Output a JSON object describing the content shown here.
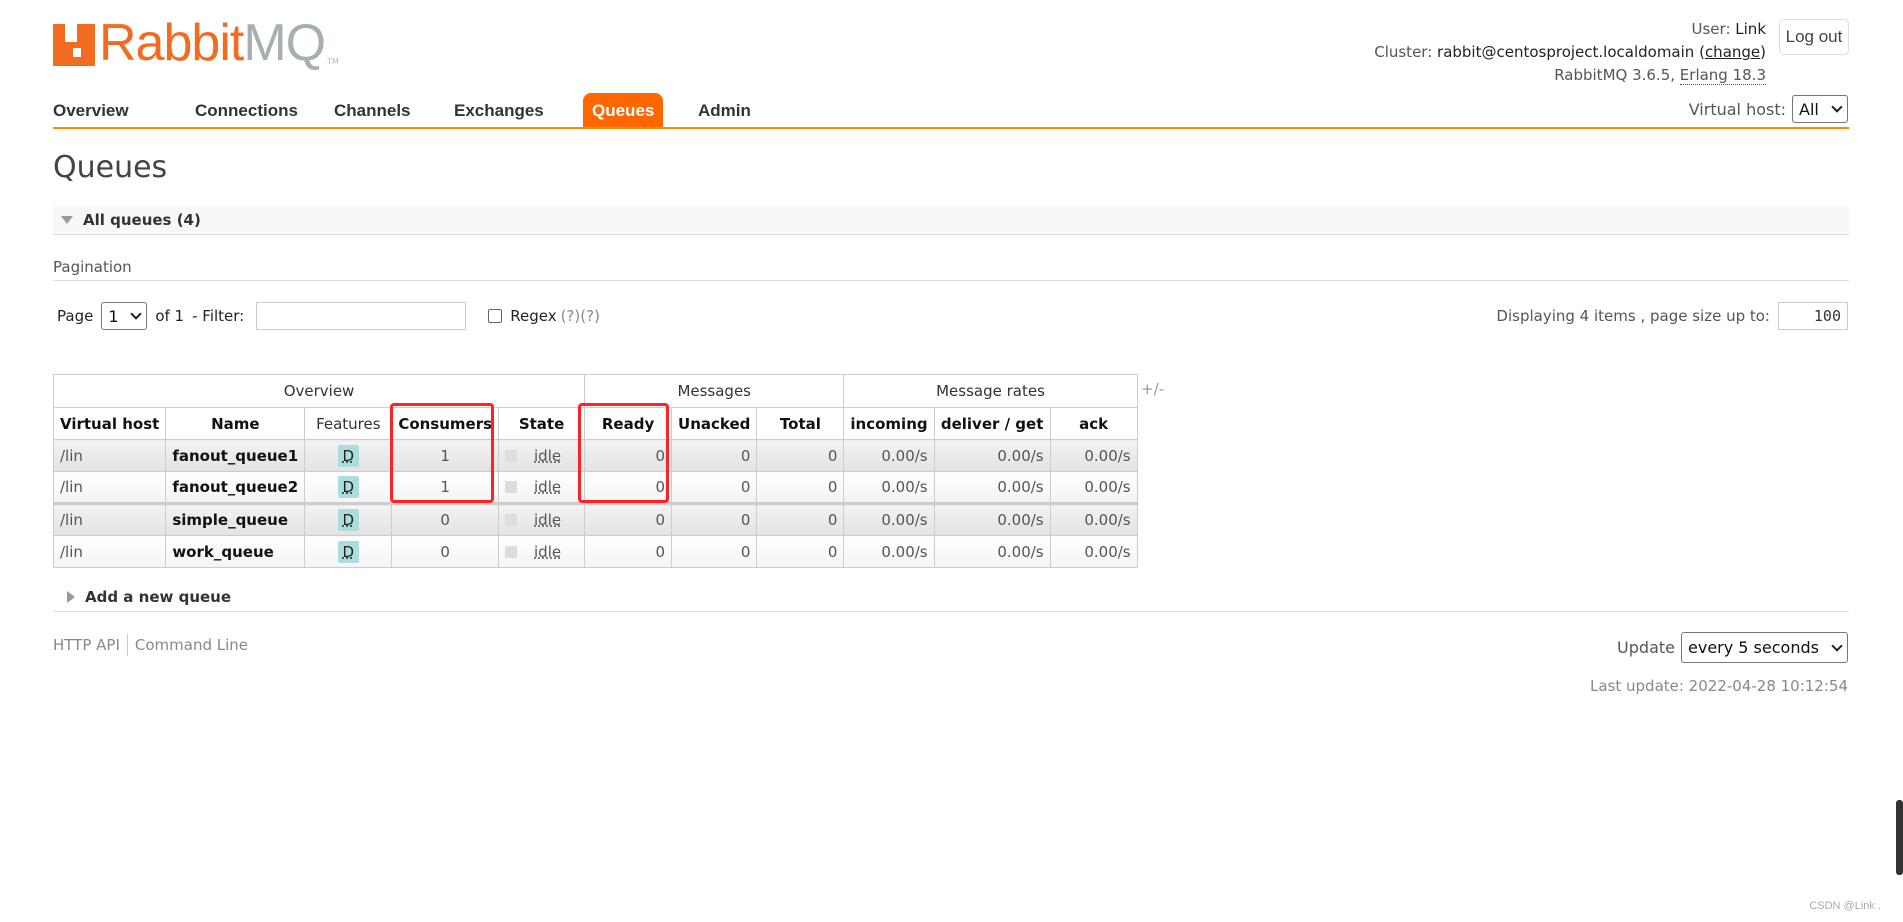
{
  "logo": {
    "text": "RabbitMQ",
    "part1": "Rabbit",
    "part2": "MQ",
    "tm": "TM"
  },
  "header": {
    "user_label": "User:",
    "user": "Link",
    "cluster_label": "Cluster:",
    "cluster": "rabbit@centosproject.localdomain",
    "change_label": "change",
    "version": "RabbitMQ 3.6.5,",
    "erlang": "Erlang 18.3",
    "logout_label": "Log out",
    "vhost_label": "Virtual host:",
    "vhost_value": "All"
  },
  "nav": {
    "tabs": [
      {
        "label": "Overview"
      },
      {
        "label": "Connections"
      },
      {
        "label": "Channels"
      },
      {
        "label": "Exchanges"
      },
      {
        "label": "Queues",
        "active": true
      },
      {
        "label": "Admin"
      }
    ]
  },
  "page": {
    "title": "Queues",
    "section": "All queues (4)",
    "pagination_label": "Pagination"
  },
  "pagination": {
    "page_label": "Page",
    "page_value": "1",
    "of_label": "of 1",
    "filter_label": "- Filter:",
    "filter_value": "",
    "regex_label": "Regex",
    "regex_checked": false,
    "help1": "(?)",
    "help2": "(?)",
    "display_text": "Displaying 4 items , page size up to:",
    "page_size": "100"
  },
  "table": {
    "groups": [
      "Overview",
      "Messages",
      "Message rates"
    ],
    "columns": [
      "Virtual host",
      "Name",
      "Features",
      "Consumers",
      "State",
      "Ready",
      "Unacked",
      "Total",
      "incoming",
      "deliver / get",
      "ack"
    ],
    "toggle": "+/-",
    "rows": [
      {
        "vhost": "/lin",
        "name": "fanout_queue1",
        "features": "D",
        "consumers": "1",
        "state": "idle",
        "ready": "0",
        "unacked": "0",
        "total": "0",
        "incoming": "0.00/s",
        "deliver": "0.00/s",
        "ack": "0.00/s"
      },
      {
        "vhost": "/lin",
        "name": "fanout_queue2",
        "features": "D",
        "consumers": "1",
        "state": "idle",
        "ready": "0",
        "unacked": "0",
        "total": "0",
        "incoming": "0.00/s",
        "deliver": "0.00/s",
        "ack": "0.00/s"
      },
      {
        "vhost": "/lin",
        "name": "simple_queue",
        "features": "D",
        "consumers": "0",
        "state": "idle",
        "ready": "0",
        "unacked": "0",
        "total": "0",
        "incoming": "0.00/s",
        "deliver": "0.00/s",
        "ack": "0.00/s"
      },
      {
        "vhost": "/lin",
        "name": "work_queue",
        "features": "D",
        "consumers": "0",
        "state": "idle",
        "ready": "0",
        "unacked": "0",
        "total": "0",
        "incoming": "0.00/s",
        "deliver": "0.00/s",
        "ack": "0.00/s"
      }
    ]
  },
  "add_queue": "Add a new queue",
  "footer": {
    "http_api": "HTTP API",
    "command_line": "Command Line",
    "update_label": "Update",
    "update_value": "every 5 seconds",
    "last_update": "Last update: 2022-04-28 10:12:54"
  },
  "watermark": "CSDN @Link .",
  "colors": {
    "accent": "#ff6600",
    "nav_underline": "#ff8800",
    "highlight": "#ff2222",
    "feature_badge": "#aadddd"
  }
}
